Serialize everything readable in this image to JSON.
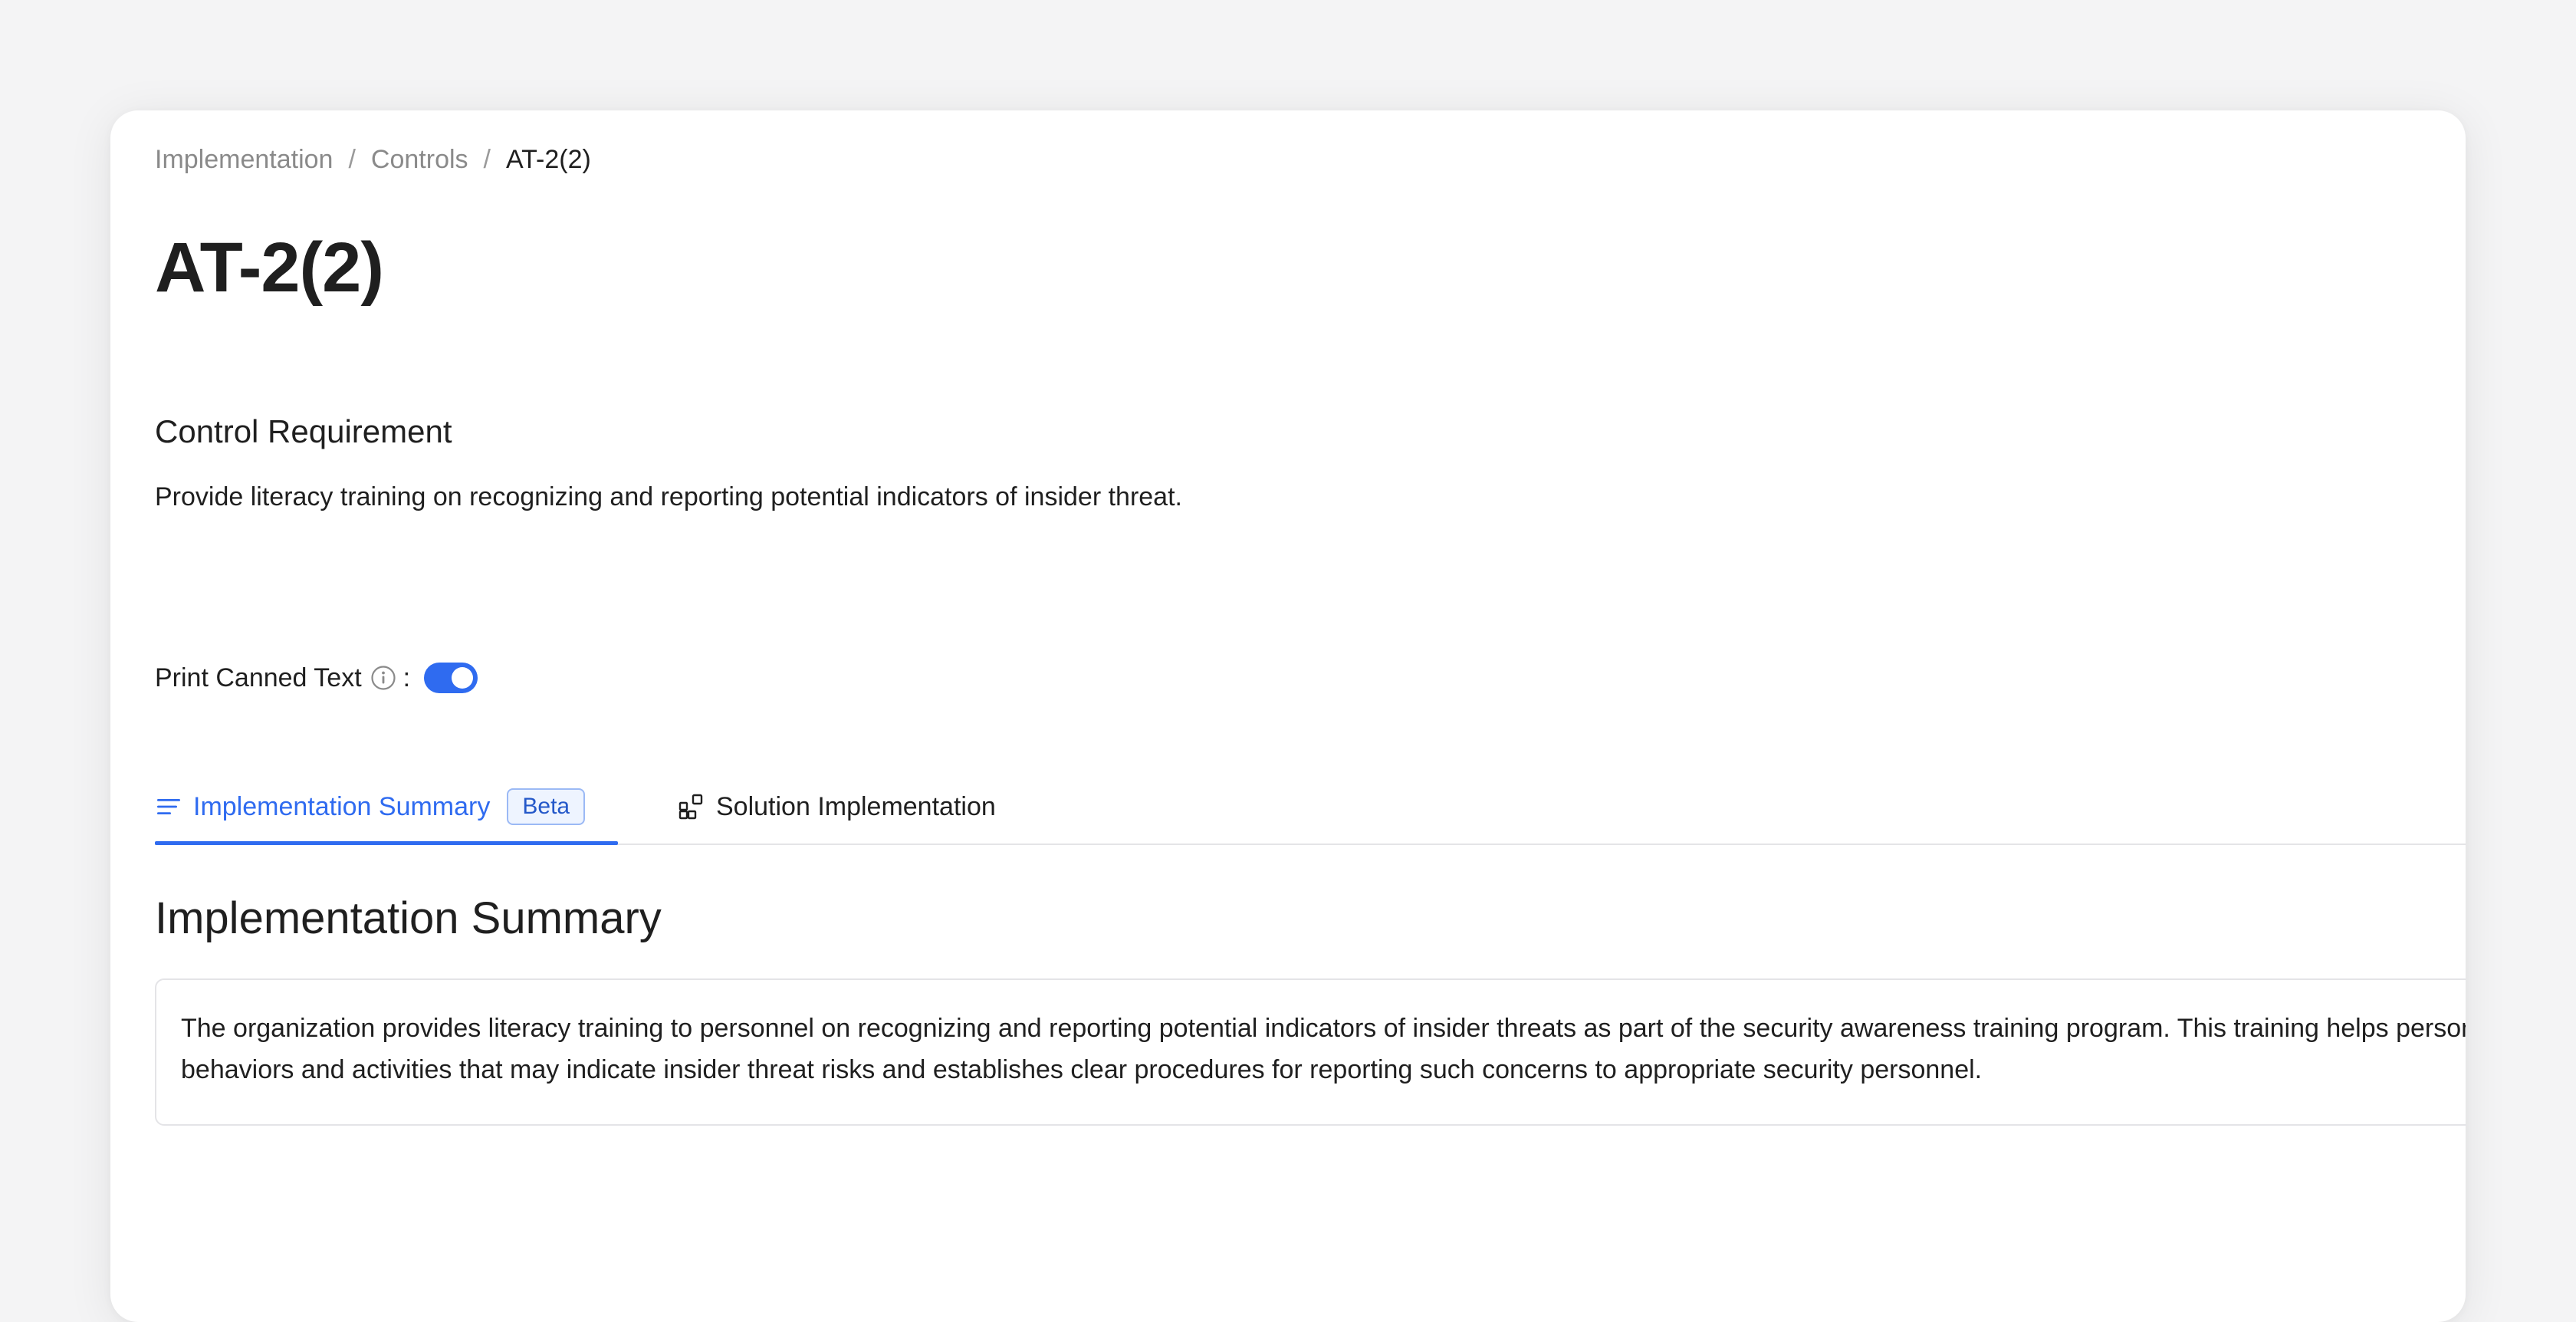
{
  "breadcrumb": {
    "items": [
      "Implementation",
      "Controls"
    ],
    "separator": "/",
    "current": "AT-2(2)"
  },
  "page": {
    "title": "AT-2(2)"
  },
  "control_requirement": {
    "heading": "Control Requirement",
    "text": "Provide literacy training on recognizing and reporting potential indicators of insider threat."
  },
  "print_canned_text": {
    "label": "Print Canned Text",
    "colon": ":",
    "enabled": true
  },
  "tabs": [
    {
      "label": "Implementation Summary",
      "badge": "Beta",
      "active": true,
      "icon": "list-icon"
    },
    {
      "label": "Solution Implementation",
      "active": false,
      "icon": "widgets-icon"
    }
  ],
  "summary": {
    "heading": "Implementation Summary",
    "text": "The organization provides literacy training to personnel on recognizing and reporting potential indicators of insider threats as part of the security awareness training program. This training helps personnel identify behaviors and activities that may indicate insider threat risks and establishes clear procedures for reporting such concerns to appropriate security personnel."
  },
  "colors": {
    "accent": "#2f6bf0",
    "text": "#1f1f1f",
    "muted": "#8a8a8a",
    "border": "#e4e4e7",
    "background": "#f4f4f5"
  }
}
